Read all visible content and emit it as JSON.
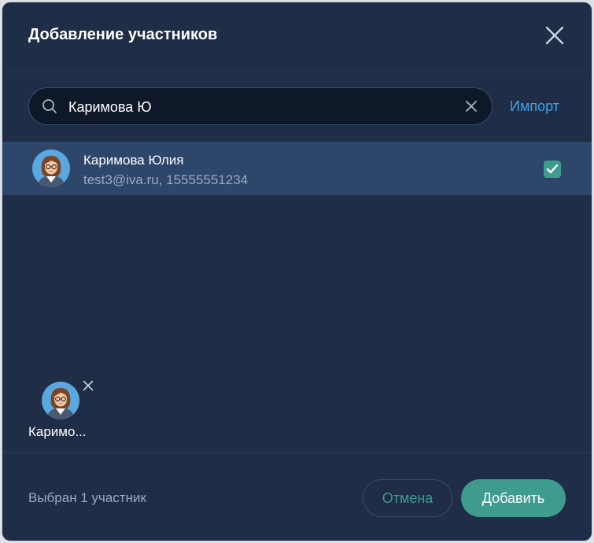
{
  "dialog": {
    "title": "Добавление участников",
    "close_icon": "close-icon"
  },
  "search": {
    "value": "Каримова Ю",
    "search_icon": "search-icon",
    "clear_icon": "clear-icon",
    "import_label": "Импорт"
  },
  "results": [
    {
      "name": "Каримова Юлия",
      "details": "test3@iva.ru, 15555551234",
      "selected": true
    }
  ],
  "selected": {
    "chips": [
      {
        "name": "Каримо..."
      }
    ]
  },
  "footer": {
    "count_label": "Выбран 1 участник",
    "cancel_label": "Отмена",
    "add_label": "Добавить"
  },
  "colors": {
    "background": "#1f2d47",
    "accent": "#3e9b8d",
    "link": "#3ea2e6",
    "selected_row": "#2d4669"
  }
}
